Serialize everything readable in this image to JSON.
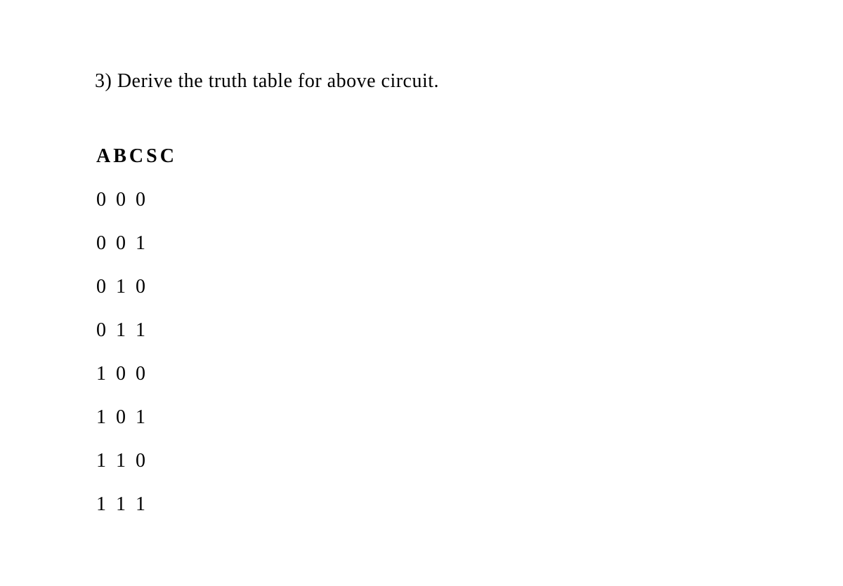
{
  "question": "3) Derive the truth table for above circuit.",
  "table": {
    "headers": [
      "A",
      "B",
      "C",
      "S",
      "C"
    ],
    "rows": [
      [
        "0",
        "0",
        "0"
      ],
      [
        "0",
        "0",
        "1"
      ],
      [
        "0",
        "1",
        "0"
      ],
      [
        "0",
        "1",
        "1"
      ],
      [
        "1",
        "0",
        "0"
      ],
      [
        "1",
        "0",
        "1"
      ],
      [
        "1",
        "1",
        "0"
      ],
      [
        "1",
        "1",
        "1"
      ]
    ]
  }
}
